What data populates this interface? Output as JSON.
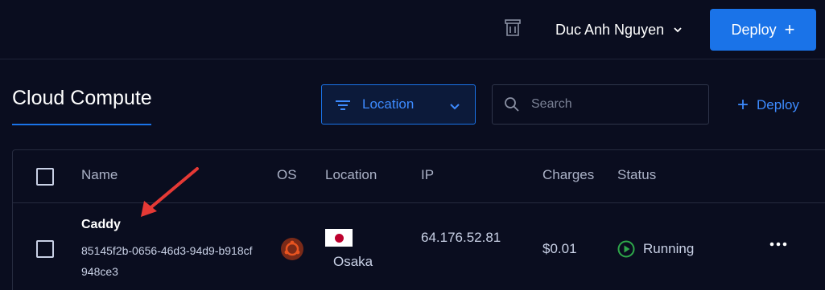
{
  "topbar": {
    "user_name": "Duc Anh Nguyen",
    "deploy_label": "Deploy",
    "deploy_plus": "+"
  },
  "page": {
    "title": "Cloud Compute",
    "filter_label": "Location",
    "search_placeholder": "Search",
    "deploy_link_label": "Deploy",
    "deploy_link_plus": "+"
  },
  "table": {
    "headers": {
      "name": "Name",
      "os": "OS",
      "location": "Location",
      "ip": "IP",
      "charges": "Charges",
      "status": "Status"
    },
    "rows": [
      {
        "name": "Caddy",
        "id": "85145f2b-0656-46d3-94d9-b918cf948ce3",
        "os_icon": "ubuntu-icon",
        "location_flag": "japan-flag-icon",
        "location": "Osaka",
        "ip": "64.176.52.81",
        "charges": "$0.01",
        "status": "Running"
      }
    ]
  },
  "colors": {
    "background": "#0a0d1f",
    "accent": "#1a73e8",
    "link": "#3d8bff",
    "running": "#2ea84a",
    "ubuntu": "#e95420",
    "annotation_arrow": "#e53935"
  }
}
